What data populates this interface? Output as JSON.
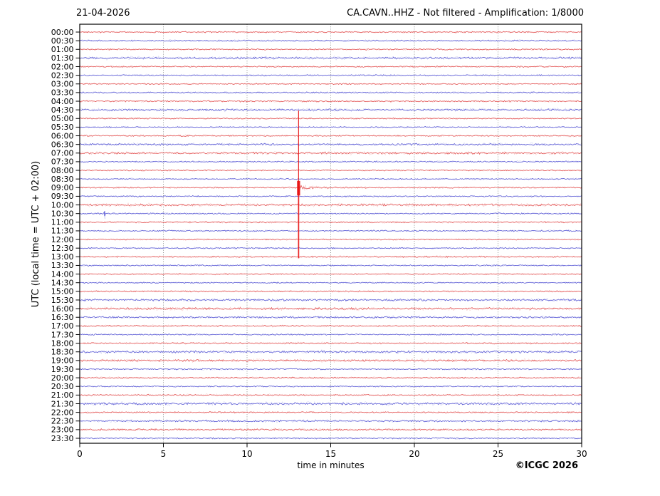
{
  "header": {
    "date_title": "21-04-2026",
    "station_title": "CA.CAVN..HHZ - Not filtered - Amplification: 1/8000"
  },
  "footer": {
    "copyright": "©ICGC 2026"
  },
  "chart_data": {
    "type": "line",
    "subtype": "helicorder-seismogram",
    "title": "21-04-2026",
    "station_code": "CA.CAVN..HHZ",
    "filter_status": "Not filtered",
    "amplification": "1/8000",
    "xlabel": "time in minutes",
    "ylabel": "UTC (local time = UTC + 02:00)",
    "xlim": [
      0,
      30
    ],
    "x_ticks": [
      0,
      5,
      10,
      15,
      20,
      25,
      30
    ],
    "x_gridlines": [
      5,
      10,
      15,
      20,
      25
    ],
    "grid_style": "vertical dotted",
    "legend": false,
    "minutes_per_row": 30,
    "rows": [
      "00:00",
      "00:30",
      "01:00",
      "01:30",
      "02:00",
      "02:30",
      "03:00",
      "03:30",
      "04:00",
      "04:30",
      "05:00",
      "05:30",
      "06:00",
      "06:30",
      "07:00",
      "07:30",
      "08:00",
      "08:30",
      "09:00",
      "09:30",
      "10:00",
      "10:30",
      "11:00",
      "11:30",
      "12:00",
      "12:30",
      "13:00",
      "13:30",
      "14:00",
      "14:30",
      "15:00",
      "15:30",
      "16:00",
      "16:30",
      "17:00",
      "17:30",
      "18:00",
      "18:30",
      "19:00",
      "19:30",
      "20:00",
      "20:30",
      "21:00",
      "21:30",
      "22:00",
      "22:30",
      "23:00",
      "23:30"
    ],
    "row_color_rule": "traces on the hour are red, traces on the half-hour are blue",
    "colors": {
      "hour_trace": "#dd3333",
      "half_hour_trace": "#3b3bcd",
      "event_spike": "#e81414",
      "gridline": "#888888",
      "axis": "#000000"
    },
    "row_noise_amp": [
      1.0,
      1.0,
      1.0,
      1.5,
      1.0,
      0.9,
      0.9,
      1.0,
      1.1,
      1.5,
      1.0,
      0.9,
      1.0,
      1.4,
      1.5,
      1.0,
      0.9,
      0.9,
      1.0,
      1.0,
      1.6,
      1.0,
      1.0,
      1.0,
      0.9,
      1.0,
      1.1,
      1.0,
      0.9,
      0.9,
      1.0,
      1.5,
      1.6,
      1.4,
      1.0,
      1.0,
      1.0,
      1.6,
      1.5,
      1.0,
      1.0,
      0.9,
      1.0,
      1.7,
      1.0,
      1.3,
      1.3,
      1.0
    ],
    "events": [
      {
        "row": "09:00",
        "minute": 13.08,
        "type": "large clipped event",
        "spike_top_row": "04:30",
        "spike_bottom_row": "13:00"
      },
      {
        "row": "10:30",
        "minute": 1.49,
        "type": "small local event"
      }
    ]
  }
}
